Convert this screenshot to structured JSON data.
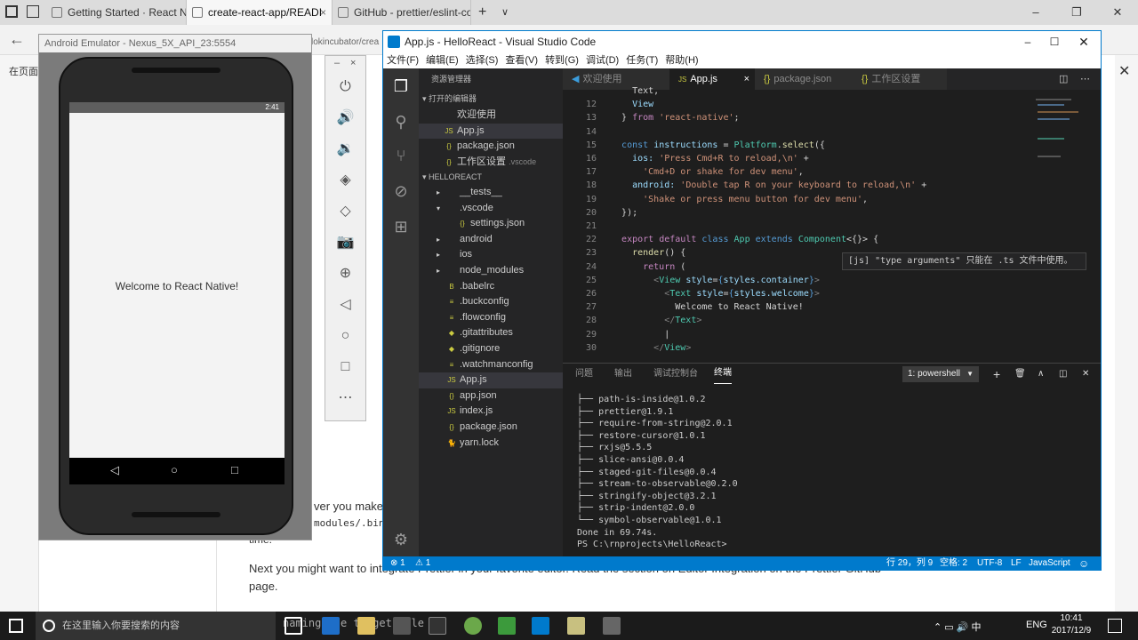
{
  "browser": {
    "tabs": [
      {
        "label": "Getting Started · React Nati"
      },
      {
        "label": "create-react-app/READI"
      },
      {
        "label": "GitHub - prettier/eslint-con"
      }
    ],
    "new_tab": "+",
    "page_left_text": "在页面上",
    "page_text": [
      "lokincubator/crea",
      "ver you make",
      "modules/.bin/p",
      "time.",
      "Next you might want to integrate Prettier in your favorite editor. Read the section on Editor Integration on the Prettier GitHub",
      "page."
    ]
  },
  "emulator": {
    "title": "Android Emulator - Nexus_5X_API_23:5554",
    "status_time": "2:41",
    "welcome": "Welcome to React Native!",
    "tools_min": "–",
    "tools_close": "×"
  },
  "vscode": {
    "title": "App.js - HelloReact - Visual Studio Code",
    "menu": [
      "文件(F)",
      "编辑(E)",
      "选择(S)",
      "查看(V)",
      "转到(G)",
      "调试(D)",
      "任务(T)",
      "帮助(H)"
    ],
    "sidebar": {
      "header": "资源管理器",
      "open_editors": "▾ 打开的编辑器",
      "open_files": [
        {
          "icon": "",
          "name": "欢迎使用",
          "extra": ""
        },
        {
          "icon": "JS",
          "name": "App.js",
          "extra": ""
        },
        {
          "icon": "{}",
          "name": "package.json",
          "extra": ""
        },
        {
          "icon": "{}",
          "name": "工作区设置",
          "extra": ".vscode"
        }
      ],
      "project": "▾ HELLOREACT",
      "tree": [
        {
          "arrow": "▸",
          "icon": "",
          "name": "__tests__",
          "indent": 1
        },
        {
          "arrow": "▾",
          "icon": "",
          "name": ".vscode",
          "indent": 1
        },
        {
          "arrow": "",
          "icon": "{}",
          "name": "settings.json",
          "indent": 2
        },
        {
          "arrow": "▸",
          "icon": "",
          "name": "android",
          "indent": 1
        },
        {
          "arrow": "▸",
          "icon": "",
          "name": "ios",
          "indent": 1
        },
        {
          "arrow": "▸",
          "icon": "",
          "name": "node_modules",
          "indent": 1
        },
        {
          "arrow": "",
          "icon": "B",
          "name": ".babelrc",
          "indent": 1
        },
        {
          "arrow": "",
          "icon": "≡",
          "name": ".buckconfig",
          "indent": 1
        },
        {
          "arrow": "",
          "icon": "≡",
          "name": ".flowconfig",
          "indent": 1
        },
        {
          "arrow": "",
          "icon": "◆",
          "name": ".gitattributes",
          "indent": 1
        },
        {
          "arrow": "",
          "icon": "◆",
          "name": ".gitignore",
          "indent": 1
        },
        {
          "arrow": "",
          "icon": "≡",
          "name": ".watchmanconfig",
          "indent": 1
        },
        {
          "arrow": "",
          "icon": "JS",
          "name": "App.js",
          "indent": 1
        },
        {
          "arrow": "",
          "icon": "{}",
          "name": "app.json",
          "indent": 1
        },
        {
          "arrow": "",
          "icon": "JS",
          "name": "index.js",
          "indent": 1
        },
        {
          "arrow": "",
          "icon": "{}",
          "name": "package.json",
          "indent": 1
        },
        {
          "arrow": "",
          "icon": "🐈",
          "name": "yarn.lock",
          "indent": 1
        }
      ]
    },
    "editor_tabs": [
      {
        "icon": "",
        "label": "欢迎使用"
      },
      {
        "icon": "JS",
        "label": "App.js",
        "close": "×"
      },
      {
        "icon": "{}",
        "label": "package.json"
      },
      {
        "icon": "{}",
        "label": "工作区设置"
      }
    ],
    "code_lines": [
      {
        "n": "",
        "html": "    <span class='p'>Text,</span>"
      },
      {
        "n": "12",
        "html": "    <span class='v'>View</span>"
      },
      {
        "n": "13",
        "html": "  <span class='p'>} </span><span class='kc'>from</span> <span class='s'>'react-native'</span><span class='p'>;</span>"
      },
      {
        "n": "14",
        "html": ""
      },
      {
        "n": "15",
        "html": "  <span class='k'>const</span> <span class='v'>instructions</span> <span class='p'>=</span> <span class='t'>Platform</span><span class='p'>.</span><span class='f'>select</span><span class='p'>({</span>"
      },
      {
        "n": "16",
        "html": "    <span class='v'>ios:</span> <span class='s'>'Press Cmd+R to reload,\\n'</span> <span class='p'>+</span>"
      },
      {
        "n": "17",
        "html": "      <span class='s'>'Cmd+D or shake for dev menu'</span><span class='p'>,</span>"
      },
      {
        "n": "18",
        "html": "    <span class='v'>android:</span> <span class='s'>'Double tap R on your keyboard to reload,\\n'</span> <span class='p'>+</span>"
      },
      {
        "n": "19",
        "html": "      <span class='s'>'Shake or press menu button for dev menu'</span><span class='p'>,</span>"
      },
      {
        "n": "20",
        "html": "  <span class='p'>});</span>"
      },
      {
        "n": "21",
        "html": ""
      },
      {
        "n": "22",
        "html": "  <span class='kc'>export</span> <span class='kc'>default</span> <span class='k'>class</span> <span class='t'>App</span> <span class='k'>extends</span> <span class='t'>Component</span><span class='p'>&lt;{}&gt; {</span>"
      },
      {
        "n": "23",
        "html": "    <span class='f'>render</span><span class='p'>() {</span>"
      },
      {
        "n": "24",
        "html": "      <span class='kc'>return</span> <span class='p'>(</span>"
      },
      {
        "n": "25",
        "html": "        <span class='tg'>&lt;</span><span class='t'>View</span> <span class='v'>style</span><span class='p'>=</span><span class='k'>{</span><span class='v'>styles.container</span><span class='k'>}</span><span class='tg'>&gt;</span>"
      },
      {
        "n": "26",
        "html": "          <span class='tg'>&lt;</span><span class='t'>Text</span> <span class='v'>style</span><span class='p'>=</span><span class='k'>{</span><span class='v'>styles.welcome</span><span class='k'>}</span><span class='tg'>&gt;</span>"
      },
      {
        "n": "27",
        "html": "            <span class='p'>Welcome to React Native!</span>"
      },
      {
        "n": "28",
        "html": "          <span class='tg'>&lt;/</span><span class='t'>Text</span><span class='tg'>&gt;</span>"
      },
      {
        "n": "29",
        "html": "          <span class='p'>|</span>"
      },
      {
        "n": "30",
        "html": "        <span class='tg'>&lt;/</span><span class='t'>View</span><span class='tg'>&gt;</span>"
      }
    ],
    "tooltip": "[js] \"type arguments\" 只能在 .ts 文件中使用。",
    "panel_tabs": [
      "问题",
      "输出",
      "调试控制台",
      "终端"
    ],
    "terminal_select": "1: powershell",
    "terminal_lines": [
      "├── path-is-inside@1.0.2",
      "├── prettier@1.9.1",
      "├── require-from-string@2.0.1",
      "├── restore-cursor@1.0.1",
      "├── rxjs@5.5.5",
      "├── slice-ansi@0.0.4",
      "├── staged-git-files@0.0.4",
      "├── stream-to-observable@0.2.0",
      "├── stringify-object@3.2.1",
      "├── strip-indent@2.0.0",
      "└── symbol-observable@1.0.1",
      "Done in 69.74s.",
      "PS C:\\rnprojects\\HelloReact> "
    ],
    "status": {
      "errors": "⊗ 1",
      "warnings": "⚠ 1",
      "position": "行 29，列 9",
      "spaces": "空格: 2",
      "encoding": "UTF-8",
      "eol": "LF",
      "language": "JavaScript",
      "smile": "☺"
    }
  },
  "taskbar": {
    "search_placeholder": "在这里输入你要搜索的内容",
    "lang": "ENG",
    "time": "10:41",
    "date": "2017/12/9",
    "under_text": "naming the target file"
  }
}
